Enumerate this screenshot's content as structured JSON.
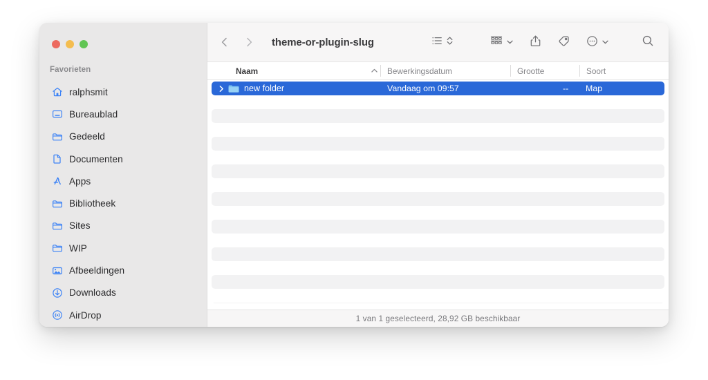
{
  "window": {
    "title": "theme-or-plugin-slug",
    "traffic_lights": [
      {
        "name": "close",
        "color": "#ec6a5f"
      },
      {
        "name": "minimize",
        "color": "#f4bd4f"
      },
      {
        "name": "maximize",
        "color": "#61c554"
      }
    ]
  },
  "sidebar": {
    "section_title": "Favorieten",
    "items": [
      {
        "label": "ralphsmit",
        "icon": "home-icon"
      },
      {
        "label": "Bureaublad",
        "icon": "desktop-icon"
      },
      {
        "label": "Gedeeld",
        "icon": "folder-icon"
      },
      {
        "label": "Documenten",
        "icon": "document-icon"
      },
      {
        "label": "Apps",
        "icon": "appstore-icon"
      },
      {
        "label": "Bibliotheek",
        "icon": "folder-icon"
      },
      {
        "label": "Sites",
        "icon": "folder-icon"
      },
      {
        "label": "WIP",
        "icon": "folder-icon"
      },
      {
        "label": "Afbeeldingen",
        "icon": "photos-icon"
      },
      {
        "label": "Downloads",
        "icon": "download-icon"
      },
      {
        "label": "AirDrop",
        "icon": "airdrop-icon"
      }
    ]
  },
  "toolbar": {
    "back": "back-icon",
    "forward": "forward-icon",
    "view_mode": "list-view-icon",
    "view_mode_stepper": "up-down-chevron-icon",
    "arrange": "group-by-icon",
    "arrange_chevron": "chevron-down-icon",
    "share": "share-icon",
    "tag": "tag-icon",
    "more": "ellipsis-circle-icon",
    "more_chevron": "chevron-down-icon",
    "search": "search-icon"
  },
  "columns": {
    "name": "Naam",
    "date": "Bewerkingsdatum",
    "size": "Grootte",
    "kind": "Soort",
    "sort_direction": "ascending"
  },
  "files": {
    "selected_row": {
      "name": "new folder",
      "date": "Vandaag om 09:57",
      "size": "--",
      "kind": "Map",
      "expanded": false,
      "selected": true
    },
    "empty_stripe_count": 9
  },
  "statusbar": {
    "text": "1 van 1 geselecteerd, 28,92 GB beschikbaar"
  },
  "colors": {
    "selection_blue": "#2a68d8",
    "sidebar_icon_blue": "#3b82f6",
    "sidebar_bg": "#e9e8e8",
    "toolbar_bg": "#f7f6f6",
    "stripe": "#f2f2f3"
  }
}
